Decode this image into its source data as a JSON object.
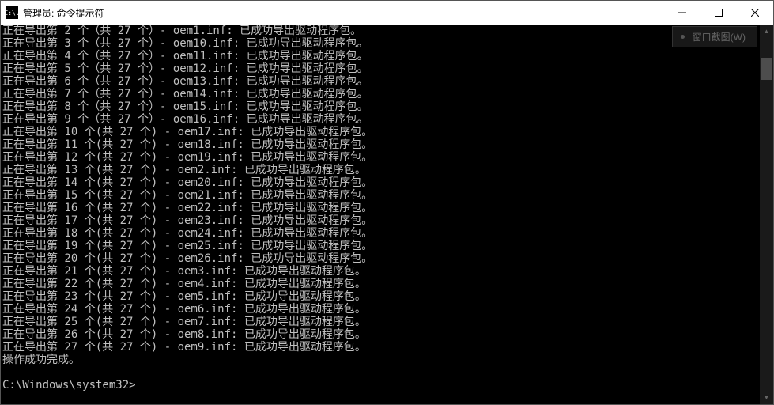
{
  "titlebar": {
    "icon_text": "C:\\.",
    "title": "管理员: 命令提示符"
  },
  "tooltip": {
    "label": "窗口截图(W)"
  },
  "terminal": {
    "lines": [
      "正在导出第 2 个（共 27 个）- oem1.inf: 已成功导出驱动程序包。",
      "正在导出第 3 个（共 27 个）- oem10.inf: 已成功导出驱动程序包。",
      "正在导出第 4 个（共 27 个）- oem11.inf: 已成功导出驱动程序包。",
      "正在导出第 5 个（共 27 个）- oem12.inf: 已成功导出驱动程序包。",
      "正在导出第 6 个（共 27 个）- oem13.inf: 已成功导出驱动程序包。",
      "正在导出第 7 个（共 27 个）- oem14.inf: 已成功导出驱动程序包。",
      "正在导出第 8 个（共 27 个）- oem15.inf: 已成功导出驱动程序包。",
      "正在导出第 9 个（共 27 个）- oem16.inf: 已成功导出驱动程序包。",
      "正在导出第 10 个(共 27 个) - oem17.inf: 已成功导出驱动程序包。",
      "正在导出第 11 个(共 27 个) - oem18.inf: 已成功导出驱动程序包。",
      "正在导出第 12 个(共 27 个) - oem19.inf: 已成功导出驱动程序包。",
      "正在导出第 13 个(共 27 个) - oem2.inf: 已成功导出驱动程序包。",
      "正在导出第 14 个(共 27 个) - oem20.inf: 已成功导出驱动程序包。",
      "正在导出第 15 个(共 27 个) - oem21.inf: 已成功导出驱动程序包。",
      "正在导出第 16 个(共 27 个) - oem22.inf: 已成功导出驱动程序包。",
      "正在导出第 17 个(共 27 个) - oem23.inf: 已成功导出驱动程序包。",
      "正在导出第 18 个(共 27 个) - oem24.inf: 已成功导出驱动程序包。",
      "正在导出第 19 个(共 27 个) - oem25.inf: 已成功导出驱动程序包。",
      "正在导出第 20 个(共 27 个) - oem26.inf: 已成功导出驱动程序包。",
      "正在导出第 21 个(共 27 个) - oem3.inf: 已成功导出驱动程序包。",
      "正在导出第 22 个(共 27 个) - oem4.inf: 已成功导出驱动程序包。",
      "正在导出第 23 个(共 27 个) - oem5.inf: 已成功导出驱动程序包。",
      "正在导出第 24 个(共 27 个) - oem6.inf: 已成功导出驱动程序包。",
      "正在导出第 25 个(共 27 个) - oem7.inf: 已成功导出驱动程序包。",
      "正在导出第 26 个(共 27 个) - oem8.inf: 已成功导出驱动程序包。",
      "正在导出第 27 个(共 27 个) - oem9.inf: 已成功导出驱动程序包。",
      "操作成功完成。",
      "",
      "C:\\Windows\\system32>"
    ]
  }
}
